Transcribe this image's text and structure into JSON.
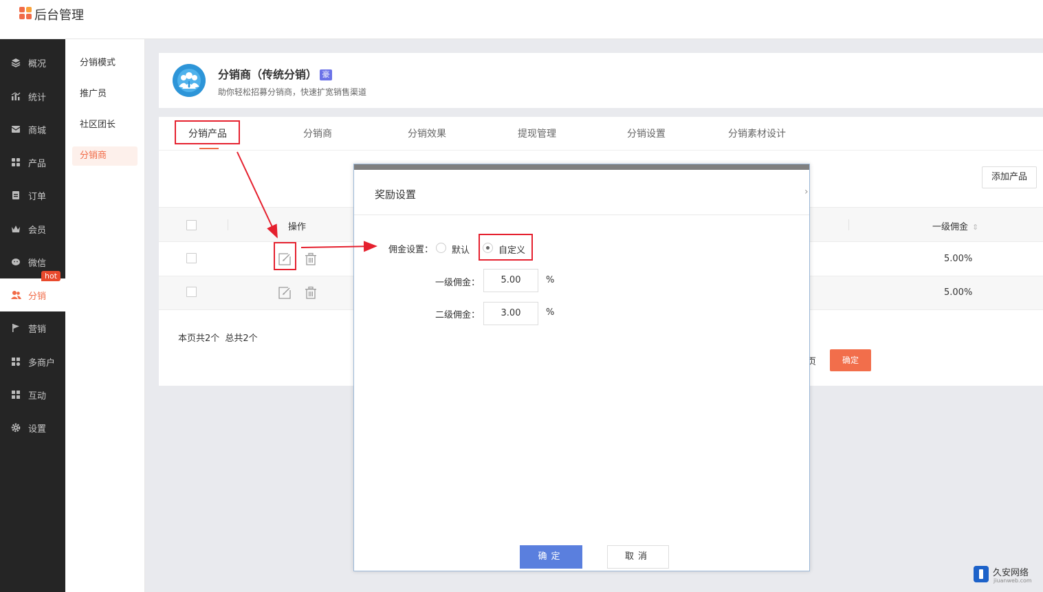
{
  "app": {
    "title": "后台管理",
    "logo_colors": [
      "#f16b47",
      "#f9a23a",
      "#f16b47",
      "#f16b47"
    ]
  },
  "sidebar": {
    "items": [
      {
        "label": "概况",
        "icon": "layers-icon"
      },
      {
        "label": "统计",
        "icon": "chart-icon"
      },
      {
        "label": "商城",
        "icon": "mail-icon"
      },
      {
        "label": "产品",
        "icon": "grid-icon"
      },
      {
        "label": "订单",
        "icon": "clipboard-icon"
      },
      {
        "label": "会员",
        "icon": "crown-icon"
      },
      {
        "label": "微信",
        "icon": "chat-icon"
      },
      {
        "label": "分销",
        "icon": "users-icon"
      },
      {
        "label": "营销",
        "icon": "flag-icon"
      },
      {
        "label": "多商户",
        "icon": "store-icon"
      },
      {
        "label": "互动",
        "icon": "apps-icon"
      },
      {
        "label": "设置",
        "icon": "gear-icon"
      }
    ],
    "active_index": 7,
    "hot_badge": "hot"
  },
  "submenu": {
    "items": [
      "分销模式",
      "推广员",
      "社区团长",
      "分销商"
    ],
    "active_index": 3
  },
  "header": {
    "title": "分销商（传统分销）",
    "badge": "豪",
    "description": "助你轻松招募分销商，快速扩宽销售渠道"
  },
  "tabs": [
    "分销产品",
    "分销商",
    "分销效果",
    "提现管理",
    "分销设置",
    "分销素材设计"
  ],
  "active_tab": 0,
  "toolbar": {
    "add_label": "添加产品"
  },
  "table": {
    "headers": {
      "operations": "操作",
      "level1": "一级佣金"
    },
    "rows": [
      {
        "level1": "5.00%"
      },
      {
        "level1": "5.00%"
      }
    ],
    "footer": "本页共2个 总共2个",
    "page_suffix": "页",
    "go_label": "确定"
  },
  "modal": {
    "title": "奖励设置",
    "close_icon": "close-icon",
    "commission_label": "佣金设置：",
    "options": [
      "默认",
      "自定义"
    ],
    "selected_option": 1,
    "level1_label": "一级佣金：",
    "level1_value": "5.00",
    "level2_label": "二级佣金：",
    "level2_value": "3.00",
    "unit": "%",
    "ok_label": "确定",
    "cancel_label": "取消"
  },
  "watermark": {
    "name": "久安网络",
    "domain": "jiuanweb.com"
  },
  "colors": {
    "accent": "#f16b47",
    "sidebar_bg": "#252525",
    "primary_button": "#5a7fde",
    "annotation_red": "#e5202e"
  }
}
